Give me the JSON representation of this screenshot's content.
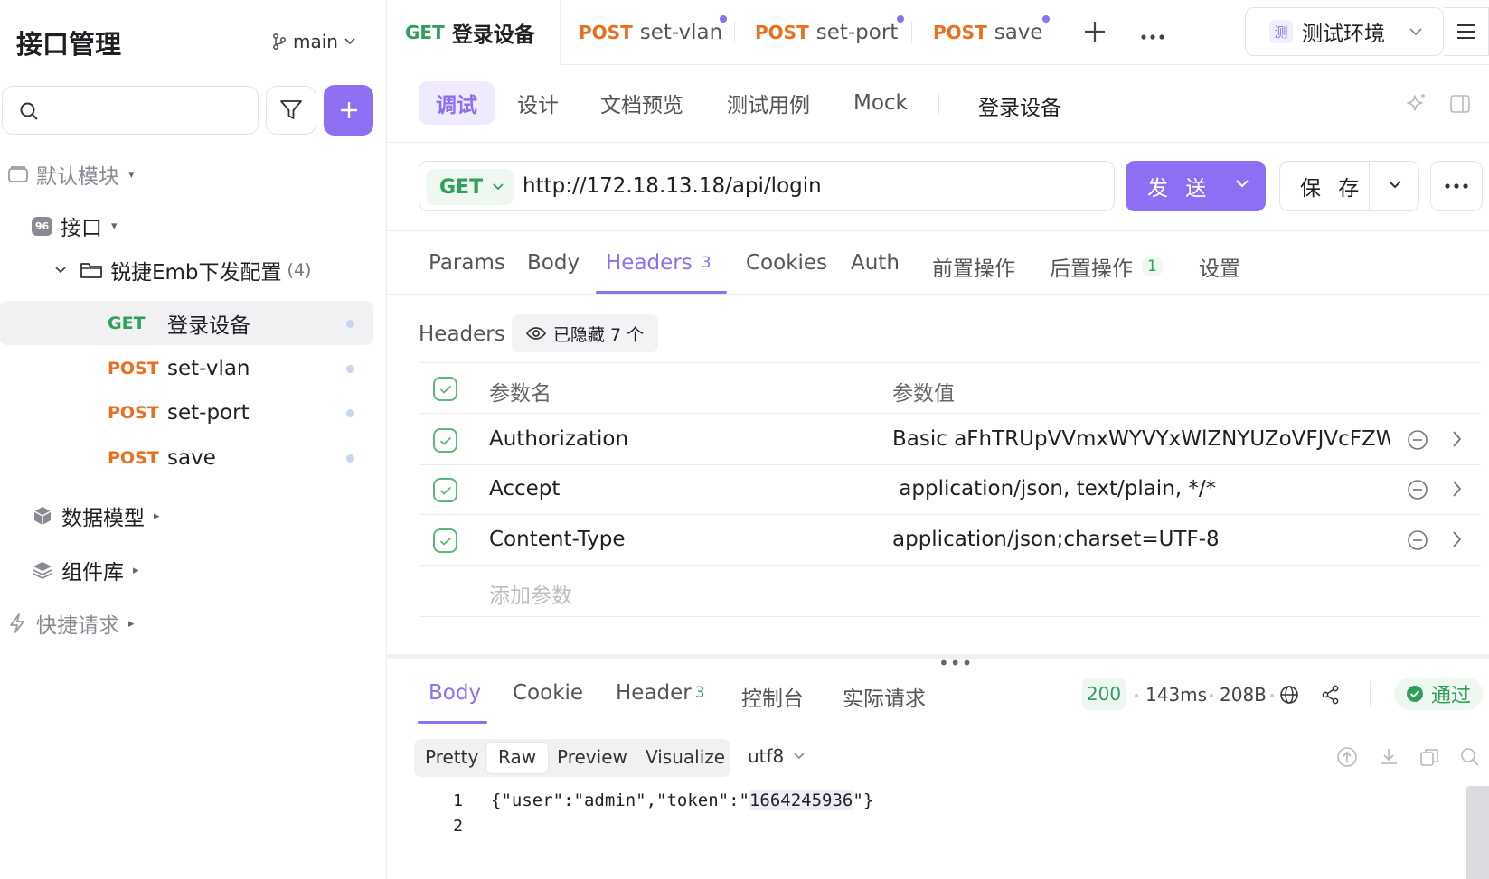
{
  "sidebar": {
    "title": "接口管理",
    "branch": "main",
    "tree": {
      "default_module": "默认模块",
      "interfaces": "接口",
      "folder": "锐捷Emb下发配置",
      "folder_count": "(4)",
      "endpoints": [
        {
          "method": "GET",
          "name": "登录设备"
        },
        {
          "method": "POST",
          "name": "set-vlan"
        },
        {
          "method": "POST",
          "name": "set-port"
        },
        {
          "method": "POST",
          "name": "save"
        }
      ],
      "data_models": "数据模型",
      "components": "组件库",
      "quick_requests": "快捷请求"
    }
  },
  "top_tabs": [
    {
      "method": "GET",
      "name": "登录设备"
    },
    {
      "method": "POST",
      "name": "set-vlan"
    },
    {
      "method": "POST",
      "name": "set-port"
    },
    {
      "method": "POST",
      "name": "save"
    }
  ],
  "env": {
    "badge": "测",
    "name": "测试环境"
  },
  "mode_tabs": [
    "调试",
    "设计",
    "文档预览",
    "测试用例",
    "Mock"
  ],
  "mode_title": "登录设备",
  "request": {
    "method": "GET",
    "url": "http://172.18.13.18/api/login",
    "send_label": "发 送",
    "save_label": "保 存"
  },
  "req_tabs": {
    "params": "Params",
    "body": "Body",
    "headers": "Headers",
    "headers_count": "3",
    "cookies": "Cookies",
    "auth": "Auth",
    "pre": "前置操作",
    "post": "后置操作",
    "post_count": "1",
    "settings": "设置"
  },
  "headers": {
    "label": "Headers",
    "hidden": "已隐藏 7 个",
    "col_name": "参数名",
    "col_value": "参数值",
    "rows": [
      {
        "name": "Authorization",
        "value": "Basic aFhTRUpVVmxWYVYxWlZNYUZoVFJVcFZWbX"
      },
      {
        "name": "Accept",
        "value": " application/json, text/plain, */*"
      },
      {
        "name": "Content-Type",
        "value": "application/json;charset=UTF-8"
      }
    ],
    "add_placeholder": "添加参数"
  },
  "response": {
    "tabs": {
      "body": "Body",
      "cookie": "Cookie",
      "header": "Header",
      "header_count": "3",
      "console": "控制台",
      "actual": "实际请求"
    },
    "status": "200",
    "time": "143ms",
    "size": "208B",
    "result": "通过",
    "formats": [
      "Pretty",
      "Raw",
      "Preview",
      "Visualize"
    ],
    "encoding": "utf8",
    "lines": [
      {
        "num": "1",
        "pre": "{\"user\":\"admin\",\"token\":\"",
        "hl": "1664245936",
        "post": "\"}"
      },
      {
        "num": "2",
        "pre": "",
        "hl": "",
        "post": ""
      }
    ]
  },
  "colors": {
    "accent": "#8e6ef2",
    "get": "#2fa05a",
    "post": "#e8701e"
  }
}
